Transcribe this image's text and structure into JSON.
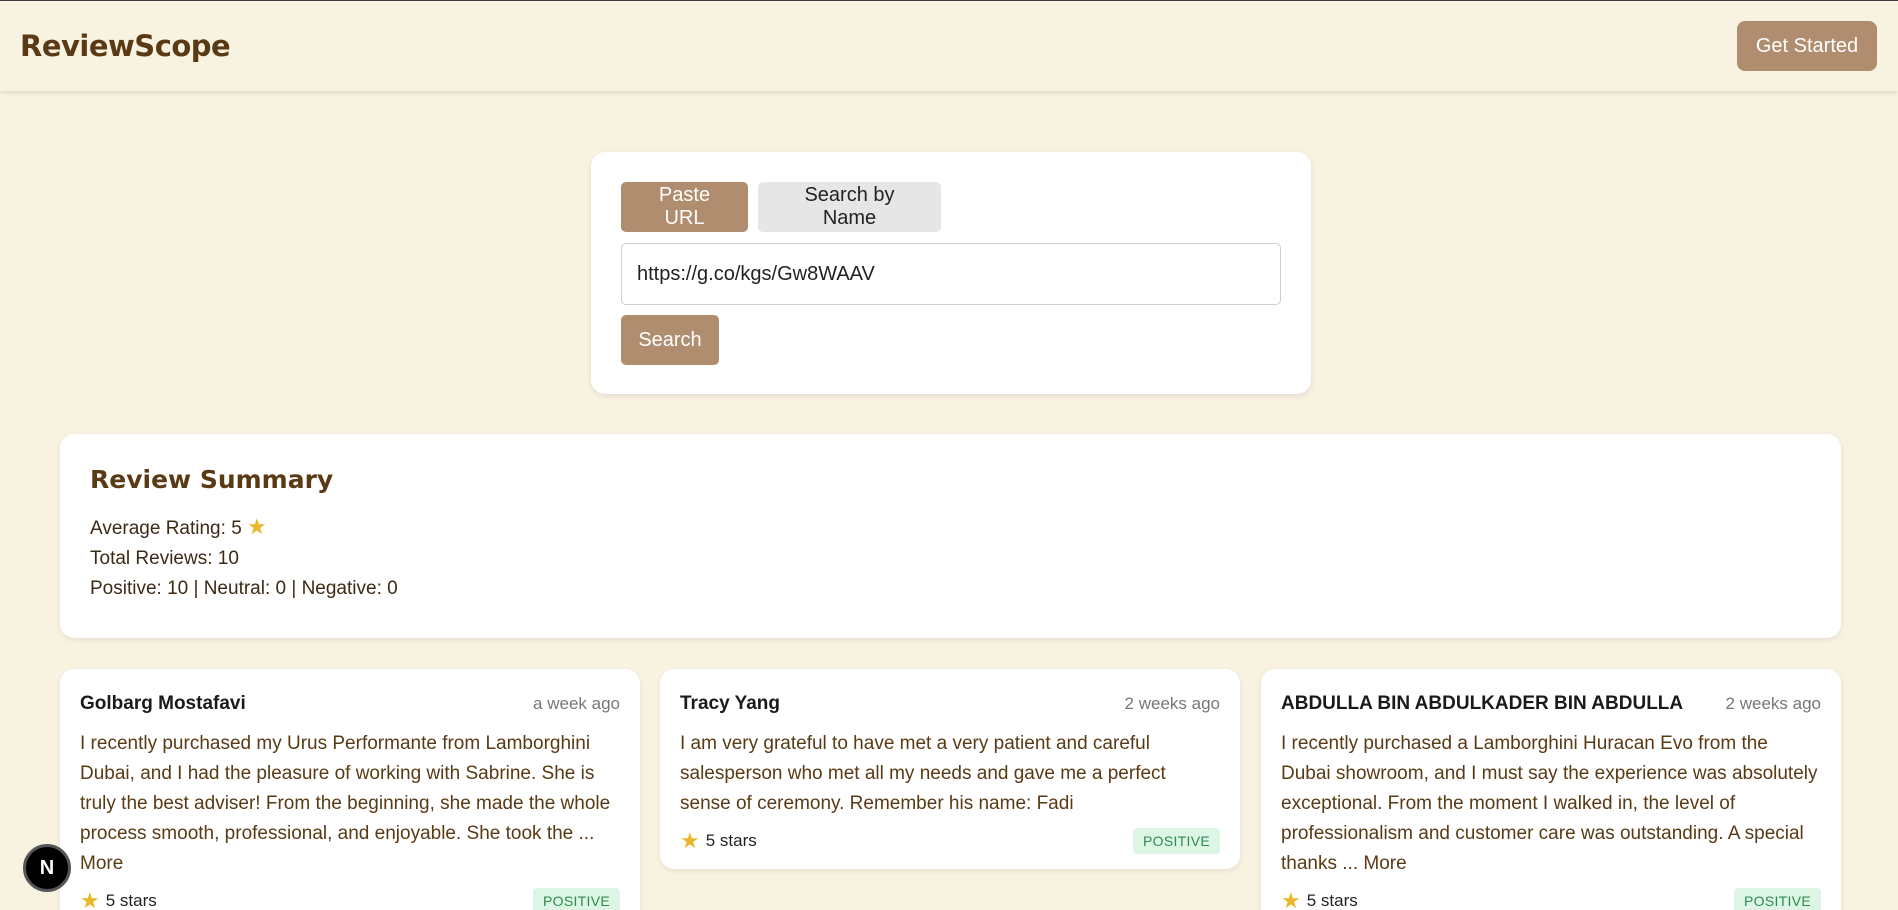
{
  "header": {
    "logo": "ReviewScope",
    "get_started": "Get Started"
  },
  "search": {
    "tab_paste": "Paste URL",
    "tab_name": "Search by Name",
    "url_value": "https://g.co/kgs/Gw8WAAV",
    "search_label": "Search"
  },
  "summary": {
    "title": "Review Summary",
    "average_rating_label": "Average Rating:",
    "average_rating": "5",
    "total_reviews_label": "Total Reviews:",
    "total_reviews": "10",
    "sentiment_line": "Positive: 10 | Neutral: 0 | Negative: 0"
  },
  "reviews": [
    {
      "name": "Golbarg Mostafavi",
      "time": "a week ago",
      "text": "I recently purchased my Urus Performante from Lamborghini Dubai, and I had the pleasure of working with Sabrine. She is truly the best adviser! From the beginning, she made the whole process smooth, professional, and enjoyable. She took the ... ",
      "more": "More",
      "stars": "5 stars",
      "sentiment": "POSITIVE"
    },
    {
      "name": "Tracy Yang",
      "time": "2 weeks ago",
      "text": "I am very grateful to have met a very patient and careful salesperson who met all my needs and gave me a perfect sense of ceremony. Remember his name: Fadi",
      "more": "",
      "stars": "5 stars",
      "sentiment": "POSITIVE"
    },
    {
      "name": "ABDULLA BIN ABDULKADER BIN ABDULLA",
      "time": "2 weeks ago",
      "text": "I recently purchased a Lamborghini Huracan Evo from the Dubai showroom, and I must say the experience was absolutely exceptional. From the moment I walked in, the level of professionalism and customer care was outstanding. A special thanks ... ",
      "more": "More",
      "stars": "5 stars",
      "sentiment": "POSITIVE"
    }
  ],
  "floating_button": "N",
  "icons": {
    "star": "star-icon"
  },
  "colors": {
    "accent": "#b08d6e",
    "background": "#f8f2e1",
    "brand_text": "#5a3a14",
    "star": "#e8b82a",
    "positive_badge_bg": "#dcf5e4",
    "positive_badge_text": "#2f8a4f"
  }
}
